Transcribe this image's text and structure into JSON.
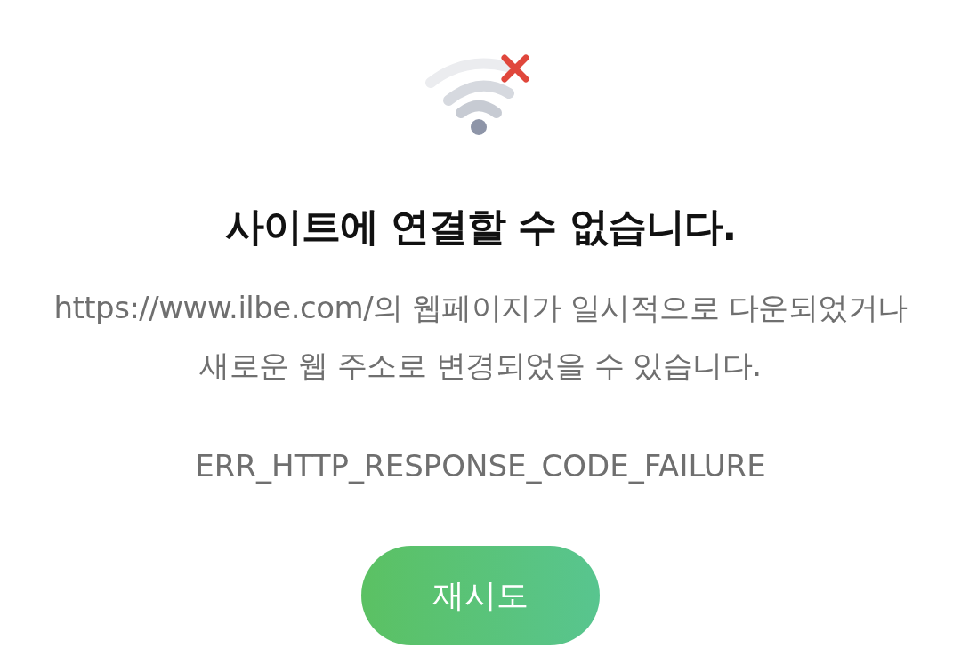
{
  "title": "사이트에 연결할 수 없습니다.",
  "message": "https://www.ilbe.com/의 웹페이지가 일시적으로 다운되었거나 새로운 웹 주소로 변경되었을 수 있습니다.",
  "error_code": "ERR_HTTP_RESPONSE_CODE_FAILURE",
  "retry_button": "재시도"
}
